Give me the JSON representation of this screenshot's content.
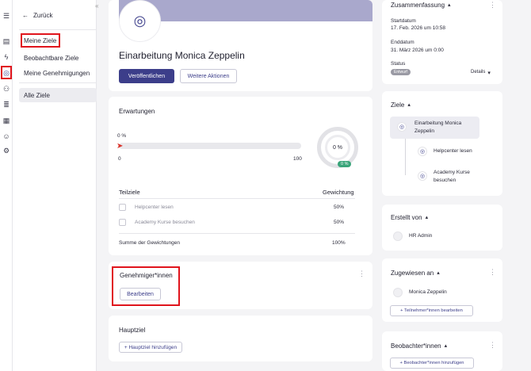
{
  "nav": {
    "back_label": "Zurück",
    "items": [
      "Meine Ziele",
      "Beobachtbare Ziele",
      "Meine Genehmigungen",
      "Alle Ziele"
    ]
  },
  "goal": {
    "title": "Einarbeitung Monica Zeppelin",
    "publish_label": "Veröffentlichen",
    "more_actions_label": "Weitere Aktionen"
  },
  "expectations": {
    "title": "Erwartungen",
    "progress_label": "0 %",
    "progress_value": 0,
    "scale_min": "0",
    "scale_max": "100",
    "gauge_label": "0 %",
    "gauge_badge": "0 %",
    "col_subgoals": "Teilziele",
    "col_weight": "Gewichtung",
    "subgoals": [
      {
        "name": "Helpcenter lesen",
        "weight": "50%"
      },
      {
        "name": "Academy Kurse besuchen",
        "weight": "50%"
      }
    ],
    "sum_label": "Summe der Gewichtungen",
    "sum_value": "100%"
  },
  "approvers": {
    "title": "Genehmiger*innen",
    "edit_label": "Bearbeiten"
  },
  "main_goal": {
    "title": "Hauptziel",
    "add_label": "+ Hauptziel hinzufügen"
  },
  "summary": {
    "title": "Zusammenfassung",
    "start_label": "Startdatum",
    "start_value": "17. Feb. 2026 um 10:58",
    "end_label": "Enddatum",
    "end_value": "31. März 2026 um 0:00",
    "status_label": "Status",
    "status_value": "Entwurf",
    "details_label": "Details"
  },
  "goals": {
    "title": "Ziele",
    "root": "Einarbeitung Monica Zeppelin",
    "children": [
      "Helpcenter lesen",
      "Academy Kurse besuchen"
    ]
  },
  "created_by": {
    "title": "Erstellt von",
    "name": "HR Admin"
  },
  "assigned": {
    "title": "Zugewiesen an",
    "name": "Monica Zeppelin",
    "edit_label": "+ Teilnehmer*innen bearbeiten"
  },
  "observers": {
    "title": "Beobachter*innen",
    "add_label": "+ Beobachter*innen hinzufügen"
  },
  "colors": {
    "accent": "#3c3e8a",
    "header_band": "#a9a8cc",
    "highlight": "#e0141c"
  }
}
